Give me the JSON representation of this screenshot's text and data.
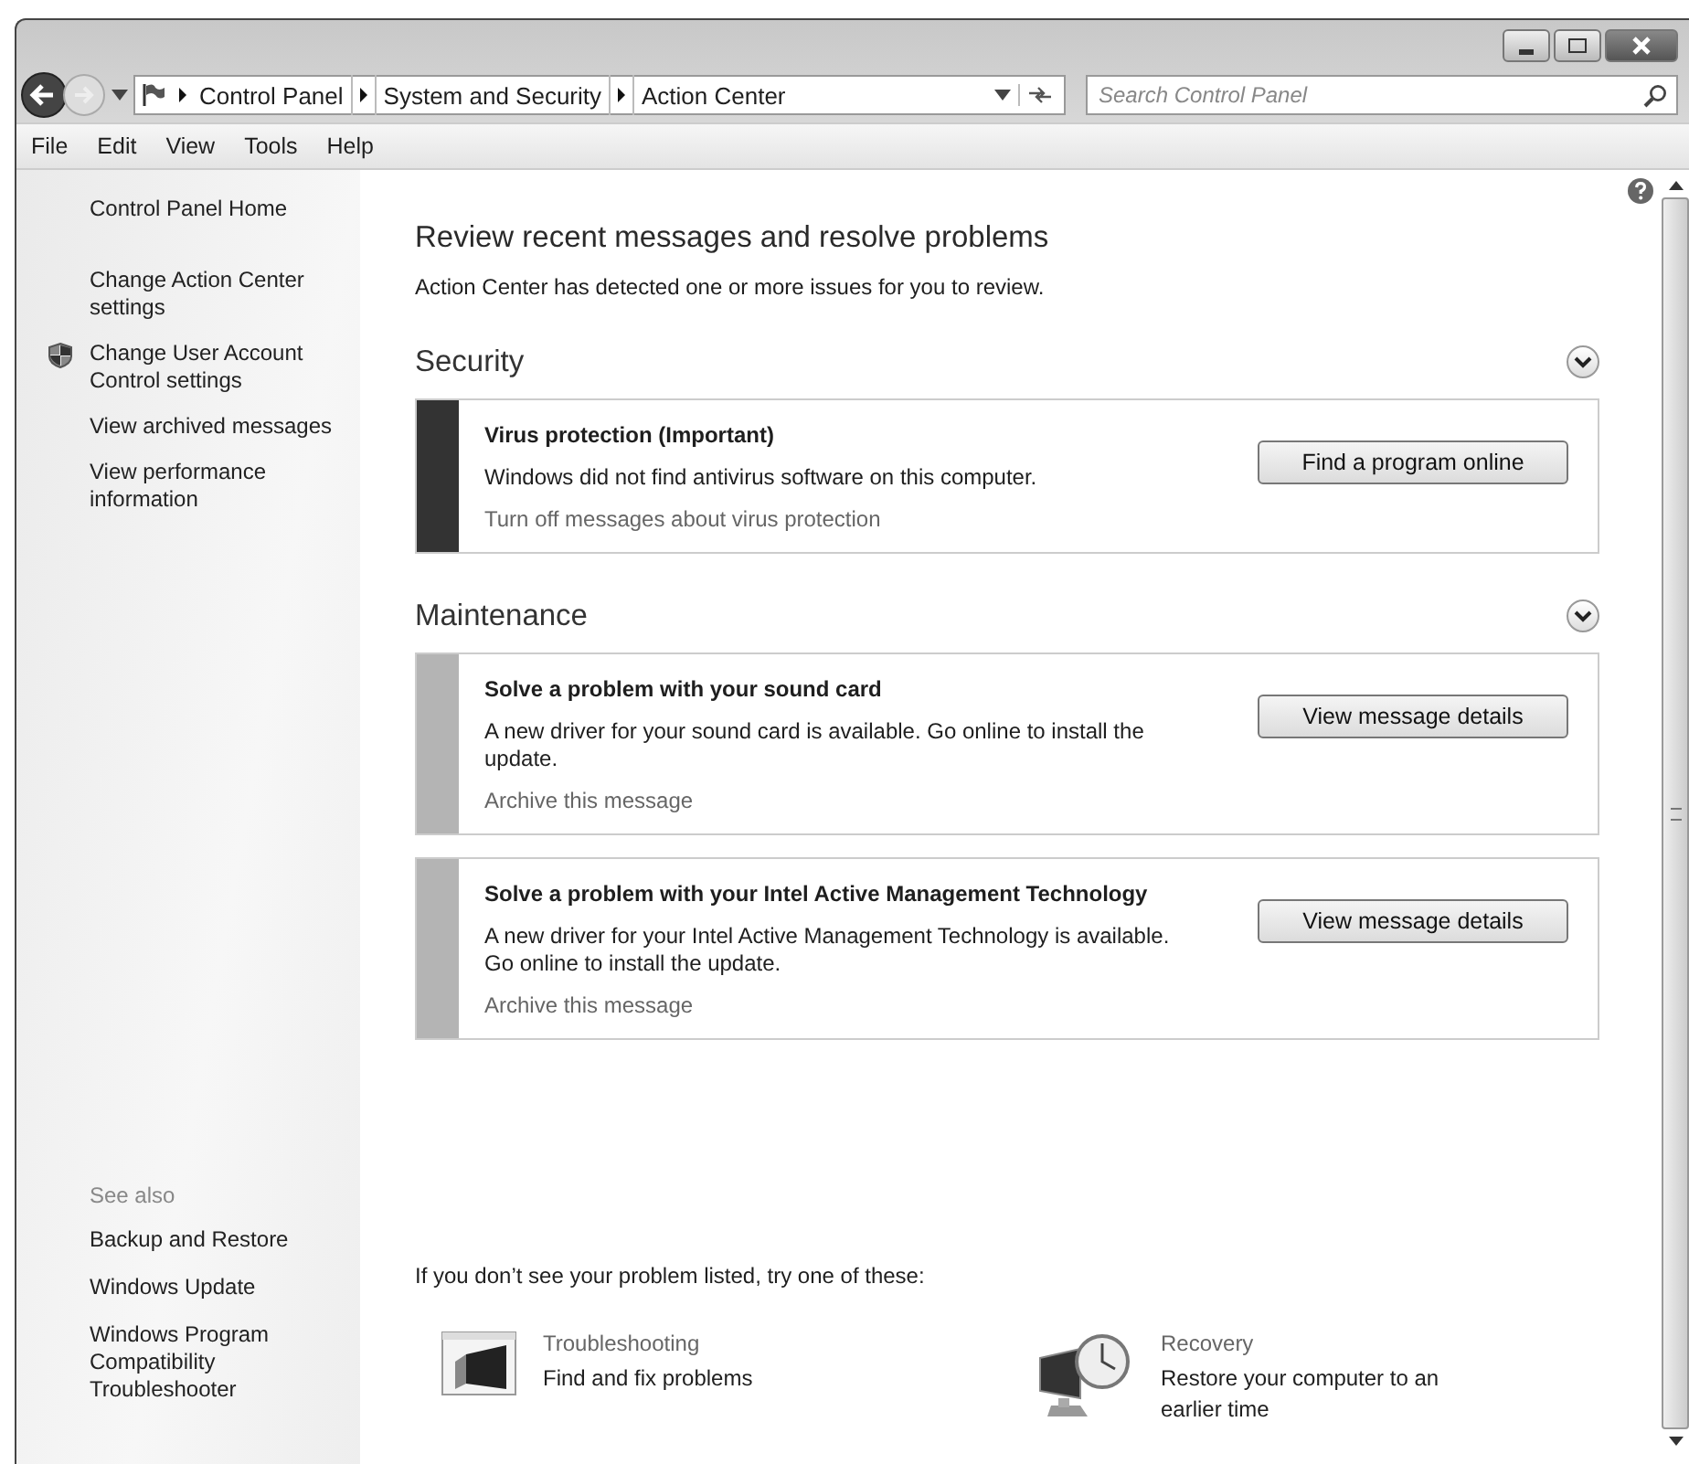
{
  "address_bar": {
    "breadcrumbs": [
      "Control Panel",
      "System and Security",
      "Action Center"
    ],
    "search_placeholder": "Search Control Panel"
  },
  "menu": [
    "File",
    "Edit",
    "View",
    "Tools",
    "Help"
  ],
  "sidebar": {
    "items": [
      {
        "label": "Control Panel Home",
        "kind": "link"
      },
      {
        "label": "Change Action Center settings",
        "kind": "link"
      },
      {
        "label": "Change User Account Control settings",
        "kind": "shield"
      },
      {
        "label": "View archived messages",
        "kind": "link"
      },
      {
        "label": "View performance information",
        "kind": "link"
      }
    ],
    "see_also_title": "See also",
    "see_also": [
      "Backup and Restore",
      "Windows Update",
      "Windows Program Compatibility Troubleshooter"
    ]
  },
  "main": {
    "title": "Review recent messages and resolve problems",
    "subtitle": "Action Center has detected one or more issues for you to review.",
    "sections": [
      {
        "heading": "Security",
        "expanded": true,
        "messages": [
          {
            "title": "Virus protection  (Important)",
            "text": "Windows did not find antivirus software on this computer.",
            "link": "Turn off messages about virus protection",
            "button": "Find a program online",
            "color": "#333333"
          }
        ]
      },
      {
        "heading": "Maintenance",
        "expanded": true,
        "messages": [
          {
            "title": "Solve a problem with your sound card",
            "text": "A new driver for your sound card is available. Go online to install the update.",
            "link": "Archive this message",
            "button": "View message details",
            "color": "#b4b4b4"
          },
          {
            "title": "Solve a problem with your Intel Active Management Technology",
            "text": "A new driver for your Intel Active Management Technology is available. Go online to install the update.",
            "link": "Archive this message",
            "button": "View message details",
            "color": "#b4b4b4"
          }
        ]
      }
    ],
    "footer_prompt": "If you don’t see your problem listed, try one of these:",
    "tools": [
      {
        "kind": "troubleshooting",
        "title": "Troubleshooting",
        "text": "Find and fix problems"
      },
      {
        "kind": "recovery",
        "title": "Recovery",
        "text": "Restore your computer to an earlier time"
      }
    ]
  }
}
